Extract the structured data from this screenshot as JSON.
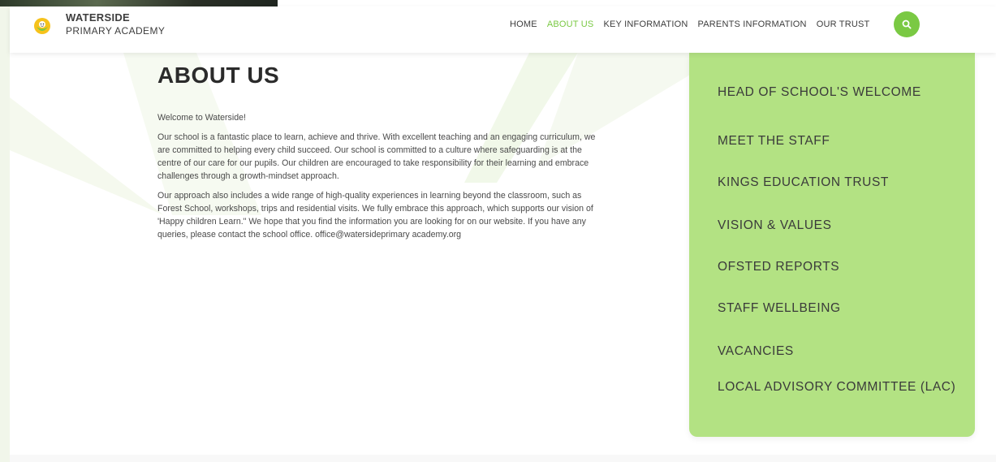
{
  "header": {
    "brand_line1": "WATERSIDE",
    "brand_line2": "PRIMARY ACADEMY",
    "nav": [
      {
        "label": "HOME",
        "active": false
      },
      {
        "label": "ABOUT US",
        "active": true
      },
      {
        "label": "KEY INFORMATION",
        "active": false
      },
      {
        "label": "PARENTS INFORMATION",
        "active": false
      },
      {
        "label": "OUR TRUST",
        "active": false
      }
    ],
    "search_icon": "search-icon"
  },
  "main": {
    "title": "ABOUT US",
    "paragraphs": [
      "Welcome to Waterside!",
      "Our school is a fantastic place to learn, achieve and thrive. With excellent teaching and an engaging curriculum, we are committed to helping every child succeed. Our school is committed to a culture where safeguarding is at the centre of our care for our pupils. Our children are encouraged to take responsibility for their learning and embrace challenges through a growth-mindset approach.",
      "Our approach also includes a wide range of high-quality experiences in learning beyond the classroom, such as Forest School, workshops, trips and residential visits. We fully embrace this approach, which supports our vision of 'Happy children Learn.\" We hope that you find the information you are looking for on our website. If you have any queries, please contact the school office. office@watersideprimary academy.org"
    ]
  },
  "side_menu": {
    "items": [
      "HEAD OF SCHOOL'S WELCOME",
      "MEET THE STAFF",
      "KINGS EDUCATION TRUST",
      "VISION & VALUES",
      "OFSTED REPORTS",
      "STAFF WELLBEING",
      "VACANCIES",
      "LOCAL ADVISORY COMMITTEE (LAC)"
    ]
  },
  "colors": {
    "accent": "#7ac943",
    "side_menu_bg": "#b3e283",
    "page_edge": "#f1f6ea"
  }
}
